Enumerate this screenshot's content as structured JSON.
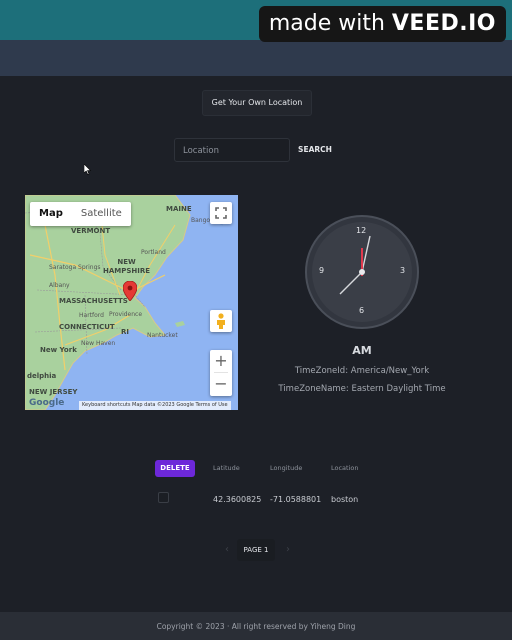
{
  "watermark": {
    "prefix": "made with ",
    "brand": "VEED.IO"
  },
  "location_button": "Get Your Own Location",
  "search": {
    "placeholder": "Location",
    "button": "SEARCH"
  },
  "map": {
    "type_options": [
      "Map",
      "Satellite"
    ],
    "selected_type": "Map",
    "labels": {
      "maine": "MAINE",
      "vermont": "VERMONT",
      "new_hampshire": "NEW\nHAMPSHIRE",
      "massachusetts": "MASSACHUSETTS",
      "connecticut": "CONNECTICUT",
      "ri": "RI",
      "new_york": "New York",
      "new_jersey": "NEW JERSEY",
      "philadelphia": "delphia",
      "providence": "Providence",
      "portland": "Portland",
      "bangor": "Bangor",
      "albany": "Albany",
      "hartford": "Hartford",
      "new_haven": "New Haven",
      "nantucket": "Nantucket",
      "saratoga": "Saratoga Springs"
    },
    "footer": "Keyboard shortcuts   Map data ©2023 Google   Terms of Use",
    "logo": "Google",
    "zoom_in": "+",
    "zoom_out": "−"
  },
  "clock": {
    "numbers": {
      "12": "12",
      "3": "3",
      "6": "6",
      "9": "9"
    },
    "period": "AM",
    "timezone_id": "TimeZoneId: America/New_York",
    "timezone_name": "TimeZoneName: Eastern Daylight Time"
  },
  "table": {
    "delete_button": "DELETE",
    "headers": {
      "latitude": "Latitude",
      "longitude": "Longitude",
      "location": "Location"
    },
    "rows": [
      {
        "latitude": "42.3600825",
        "longitude": "-71.0588801",
        "location": "boston"
      }
    ]
  },
  "pagination": {
    "label": "PAGE 1",
    "prev": "‹",
    "next": "›"
  },
  "footer": "Copyright © 2023 · All right reserved by Yiheng Ding"
}
